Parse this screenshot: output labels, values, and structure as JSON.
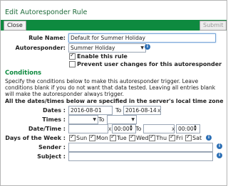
{
  "window": {
    "title": "Edit Autoresponder Rule"
  },
  "toolbar": {
    "close_label": "Close",
    "submit_label": "Submit"
  },
  "form": {
    "rule_name": {
      "label": "Rule Name:",
      "value": "Default for Summer Holiday"
    },
    "autoresponder": {
      "label": "Autoresponder:",
      "value": "Summer Holiday"
    },
    "enable_rule": {
      "label": "Enable this rule",
      "checked": true
    },
    "prevent_changes": {
      "label": "Prevent user changes for this autoresponder",
      "checked": false
    }
  },
  "conditions": {
    "heading": "Conditions",
    "description": "Specify the conditions below to make this autoresponder trigger. Leave conditions blank if you do not want that data tested. Leaving all entries blank will make the autoresponder always trigger.",
    "timezone_note": "All the dates/times below are specified in the server's local time zone",
    "dates": {
      "label": "Dates :",
      "from": "2016-08-01",
      "to_label": "To",
      "to": "2016-08-14"
    },
    "times": {
      "label": "Times :",
      "from": "",
      "to_label": "To",
      "to": ""
    },
    "datetime": {
      "label": "Date/Time :",
      "from_time": "00:00",
      "to_label": "To",
      "to_time": "00:00"
    },
    "days": {
      "label": "Days of the Week :",
      "items": [
        {
          "label": "Sun",
          "checked": true
        },
        {
          "label": "Mon",
          "checked": true
        },
        {
          "label": "Tue",
          "checked": true
        },
        {
          "label": "Wed",
          "checked": true
        },
        {
          "label": "Thu",
          "checked": true
        },
        {
          "label": "Fri",
          "checked": true
        },
        {
          "label": "Sat",
          "checked": true
        }
      ]
    },
    "sender": {
      "label": "Sender :",
      "value": ""
    },
    "subject": {
      "label": "Subject :",
      "value": ""
    }
  },
  "icons": {
    "info": "info-icon",
    "clear": "x",
    "info_glyph": "i"
  },
  "colors": {
    "accent": "#0e8a3f",
    "title": "#1e6b3a",
    "info": "#2c6fb5"
  }
}
